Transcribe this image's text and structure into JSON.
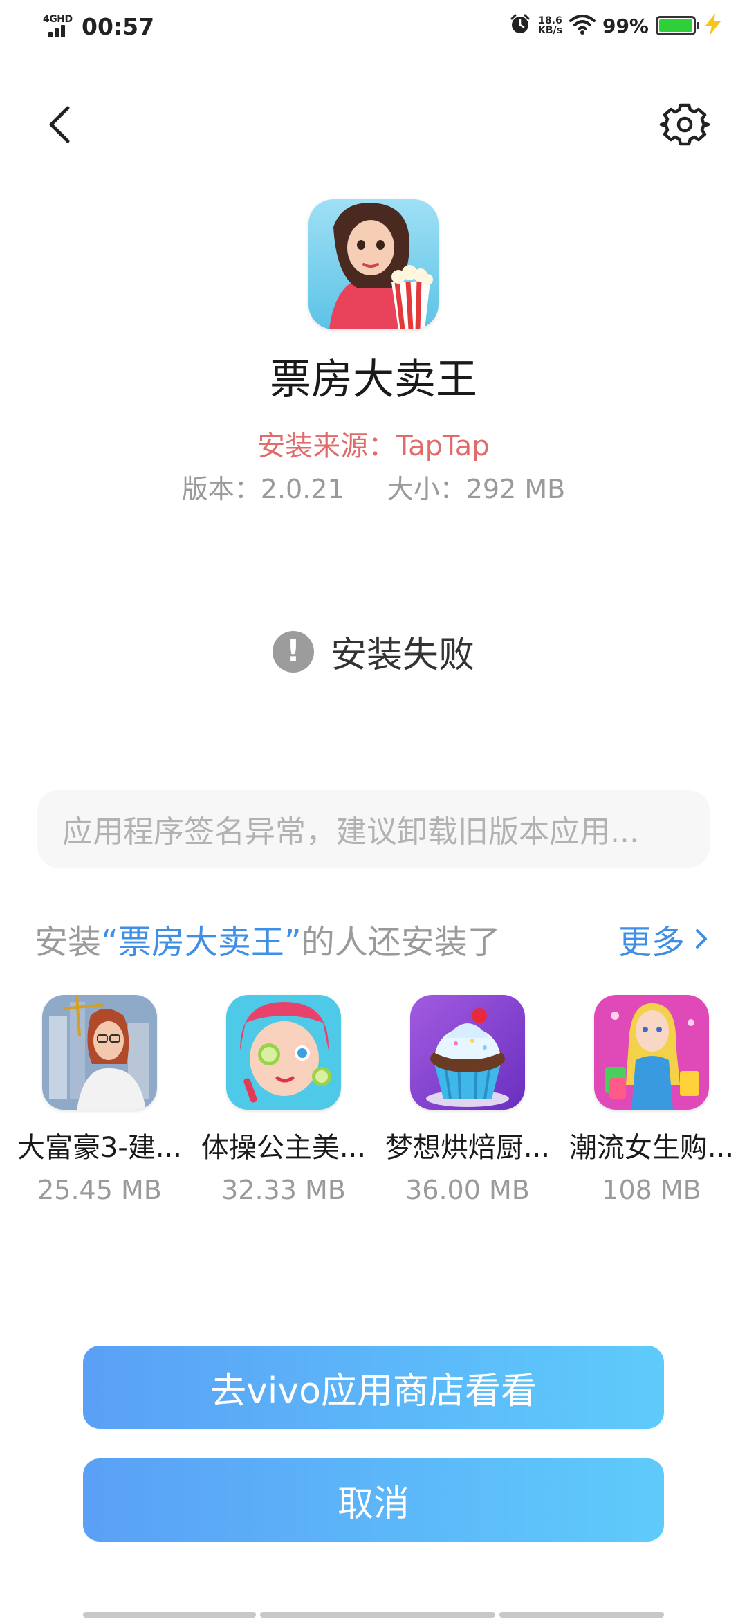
{
  "status_bar": {
    "network_type": "4GHD",
    "time": "00:57",
    "net_speed_value": "18.6",
    "net_speed_unit": "KB/s",
    "battery_percent": "99%",
    "battery_level": 0.99,
    "battery_color": "#2fcf3a"
  },
  "header": {
    "back_icon": "chevron-left-icon",
    "settings_icon": "gear-icon"
  },
  "app": {
    "name": "票房大卖王",
    "install_source": "安装来源：TapTap",
    "version": "版本：2.0.21",
    "size": "大小：292 MB",
    "source_color": "#e06b6b"
  },
  "install_status": {
    "icon_glyph": "!",
    "text": "安装失败"
  },
  "error_message": "应用程序签名异常，建议卸载旧版本应用...",
  "recommendations": {
    "title_prefix": "安装",
    "title_app": "“票房大卖王”",
    "title_suffix": "的人还安装了",
    "more_label": "更多",
    "accent_color": "#3f8fe6",
    "items": [
      {
        "name": "大富豪3-建...",
        "size": "25.45 MB"
      },
      {
        "name": "体操公主美...",
        "size": "32.33 MB"
      },
      {
        "name": "梦想烘焙厨...",
        "size": "36.00 MB"
      },
      {
        "name": "潮流女生购...",
        "size": "108 MB"
      }
    ]
  },
  "buttons": {
    "store_label": "去vivo应用商店看看",
    "cancel_label": "取消",
    "gradient_start": "#5aa0f6",
    "gradient_end": "#5ecbfb"
  }
}
